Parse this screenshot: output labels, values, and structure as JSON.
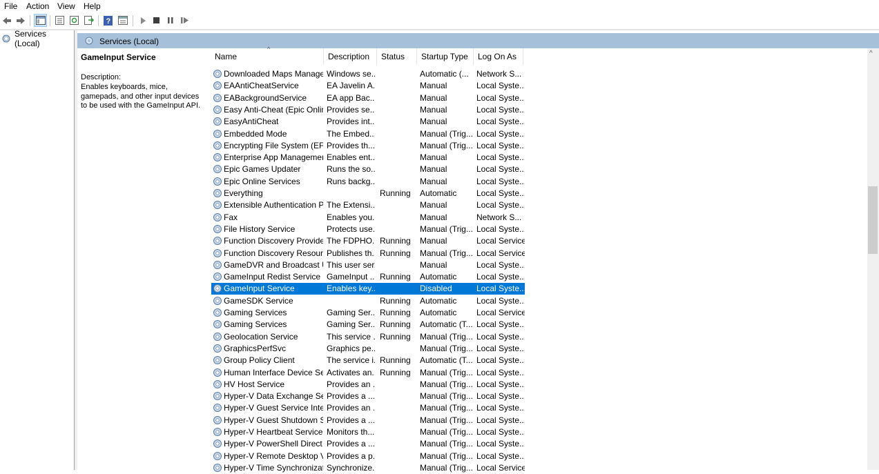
{
  "menu": [
    "File",
    "Action",
    "View",
    "Help"
  ],
  "tree": {
    "root_label": "Services (Local)"
  },
  "banner": {
    "title": "Services (Local)"
  },
  "detail": {
    "service_name": "GameInput Service",
    "description_label": "Description:",
    "description_text": "Enables keyboards, mice, gamepads, and other input devices to be used with the GameInput API."
  },
  "columns": [
    "Name",
    "Description",
    "Status",
    "Startup Type",
    "Log On As"
  ],
  "rows": [
    [
      "Downloaded Maps Manager",
      "Windows se...",
      "",
      "Automatic (...",
      "Network S..."
    ],
    [
      "EAAntiCheatService",
      "EA Javelin A...",
      "",
      "Manual",
      "Local Syste..."
    ],
    [
      "EABackgroundService",
      "EA app Bac...",
      "",
      "Manual",
      "Local Syste..."
    ],
    [
      "Easy Anti-Cheat (Epic Onlin...",
      "Provides se...",
      "",
      "Manual",
      "Local Syste..."
    ],
    [
      "EasyAntiCheat",
      "Provides int...",
      "",
      "Manual",
      "Local Syste..."
    ],
    [
      "Embedded Mode",
      "The Embed...",
      "",
      "Manual (Trig...",
      "Local Syste..."
    ],
    [
      "Encrypting File System (EFS)",
      "Provides th...",
      "",
      "Manual (Trig...",
      "Local Syste..."
    ],
    [
      "Enterprise App Managemen...",
      "Enables ent...",
      "",
      "Manual",
      "Local Syste..."
    ],
    [
      "Epic Games Updater",
      "Runs the so...",
      "",
      "Manual",
      "Local Syste..."
    ],
    [
      "Epic Online Services",
      "Runs backg...",
      "",
      "Manual",
      "Local Syste..."
    ],
    [
      "Everything",
      "",
      "Running",
      "Automatic",
      "Local Syste..."
    ],
    [
      "Extensible Authentication P...",
      "The Extensi...",
      "",
      "Manual",
      "Local Syste..."
    ],
    [
      "Fax",
      "Enables you...",
      "",
      "Manual",
      "Network S..."
    ],
    [
      "File History Service",
      "Protects use...",
      "",
      "Manual (Trig...",
      "Local Syste..."
    ],
    [
      "Function Discovery Provide...",
      "The FDPHO...",
      "Running",
      "Manual",
      "Local Service"
    ],
    [
      "Function Discovery Resourc...",
      "Publishes th...",
      "Running",
      "Manual (Trig...",
      "Local Service"
    ],
    [
      "GameDVR and Broadcast Us...",
      "This user ser...",
      "",
      "Manual",
      "Local Syste..."
    ],
    [
      "GameInput Redist Service",
      "GameInput ...",
      "Running",
      "Automatic",
      "Local Syste..."
    ],
    [
      "GameInput Service",
      "Enables key...",
      "",
      "Disabled",
      "Local Syste..."
    ],
    [
      "GameSDK Service",
      "",
      "Running",
      "Automatic",
      "Local Syste..."
    ],
    [
      "Gaming Services",
      "Gaming Ser...",
      "Running",
      "Automatic",
      "Local Service"
    ],
    [
      "Gaming Services",
      "Gaming Ser...",
      "Running",
      "Automatic (T...",
      "Local Syste..."
    ],
    [
      "Geolocation Service",
      "This service ...",
      "Running",
      "Manual (Trig...",
      "Local Syste..."
    ],
    [
      "GraphicsPerfSvc",
      "Graphics pe...",
      "",
      "Manual (Trig...",
      "Local Syste..."
    ],
    [
      "Group Policy Client",
      "The service i...",
      "Running",
      "Automatic (T...",
      "Local Syste..."
    ],
    [
      "Human Interface Device Ser...",
      "Activates an...",
      "Running",
      "Manual (Trig...",
      "Local Syste..."
    ],
    [
      "HV Host Service",
      "Provides an ...",
      "",
      "Manual (Trig...",
      "Local Syste..."
    ],
    [
      "Hyper-V Data Exchange Ser...",
      "Provides a ...",
      "",
      "Manual (Trig...",
      "Local Syste..."
    ],
    [
      "Hyper-V Guest Service Inter...",
      "Provides an ...",
      "",
      "Manual (Trig...",
      "Local Syste..."
    ],
    [
      "Hyper-V Guest Shutdown S...",
      "Provides a ...",
      "",
      "Manual (Trig...",
      "Local Syste..."
    ],
    [
      "Hyper-V Heartbeat Service",
      "Monitors th...",
      "",
      "Manual (Trig...",
      "Local Syste..."
    ],
    [
      "Hyper-V PowerShell Direct ...",
      "Provides a ...",
      "",
      "Manual (Trig...",
      "Local Syste..."
    ],
    [
      "Hyper-V Remote Desktop Vi...",
      "Provides a p...",
      "",
      "Manual (Trig...",
      "Local Syste..."
    ],
    [
      "Hyper-V Time Synchronizati...",
      "Synchronize...",
      "",
      "Manual (Trig...",
      "Local Service"
    ]
  ],
  "selected_row": 18
}
